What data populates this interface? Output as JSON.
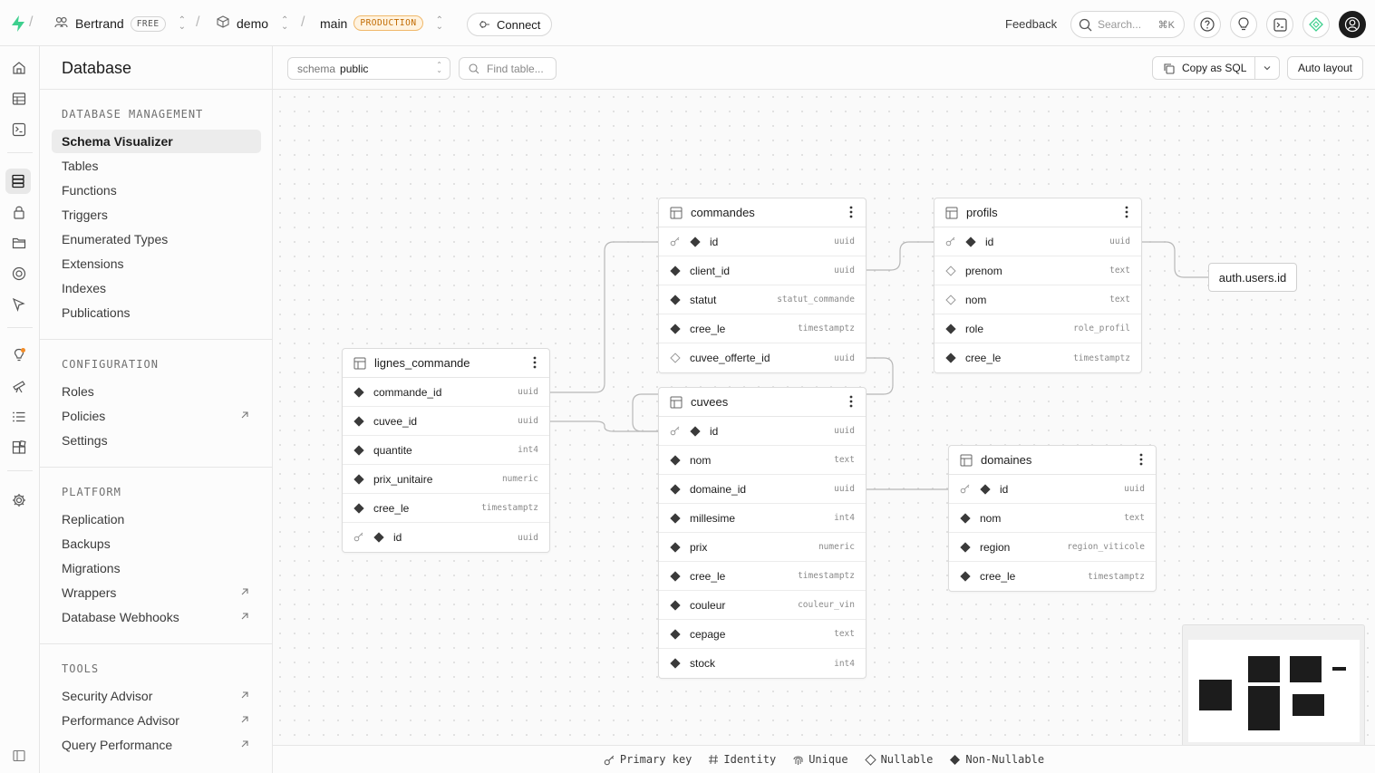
{
  "topbar": {
    "org": "Bertrand",
    "org_badge": "FREE",
    "project": "demo",
    "branch": "main",
    "branch_badge": "PRODUCTION",
    "connect_label": "Connect",
    "feedback_label": "Feedback",
    "search_placeholder": "Search...",
    "search_shortcut": "⌘K"
  },
  "sidebar": {
    "title": "Database",
    "sections": [
      {
        "heading": "DATABASE MANAGEMENT",
        "items": [
          {
            "label": "Schema Visualizer",
            "active": true
          },
          {
            "label": "Tables"
          },
          {
            "label": "Functions"
          },
          {
            "label": "Triggers"
          },
          {
            "label": "Enumerated Types"
          },
          {
            "label": "Extensions"
          },
          {
            "label": "Indexes"
          },
          {
            "label": "Publications"
          }
        ]
      },
      {
        "heading": "CONFIGURATION",
        "items": [
          {
            "label": "Roles"
          },
          {
            "label": "Policies",
            "external": true
          },
          {
            "label": "Settings"
          }
        ]
      },
      {
        "heading": "PLATFORM",
        "items": [
          {
            "label": "Replication"
          },
          {
            "label": "Backups"
          },
          {
            "label": "Migrations"
          },
          {
            "label": "Wrappers",
            "external": true
          },
          {
            "label": "Database Webhooks",
            "external": true
          }
        ]
      },
      {
        "heading": "TOOLS",
        "items": [
          {
            "label": "Security Advisor",
            "external": true
          },
          {
            "label": "Performance Advisor",
            "external": true
          },
          {
            "label": "Query Performance",
            "external": true
          }
        ]
      }
    ]
  },
  "toolbar": {
    "schema_prefix": "schema",
    "schema_value": "public",
    "find_placeholder": "Find table...",
    "copy_sql_label": "Copy as SQL",
    "auto_layout_label": "Auto layout"
  },
  "tables": [
    {
      "name": "commandes",
      "columns": [
        {
          "name": "id",
          "type": "uuid",
          "pk": true
        },
        {
          "name": "client_id",
          "type": "uuid"
        },
        {
          "name": "statut",
          "type": "statut_commande"
        },
        {
          "name": "cree_le",
          "type": "timestamptz"
        },
        {
          "name": "cuvee_offerte_id",
          "type": "uuid",
          "nullable": true
        }
      ]
    },
    {
      "name": "profils",
      "columns": [
        {
          "name": "id",
          "type": "uuid",
          "pk": true
        },
        {
          "name": "prenom",
          "type": "text",
          "nullable": true
        },
        {
          "name": "nom",
          "type": "text",
          "nullable": true
        },
        {
          "name": "role",
          "type": "role_profil"
        },
        {
          "name": "cree_le",
          "type": "timestamptz"
        }
      ]
    },
    {
      "name": "lignes_commande",
      "columns": [
        {
          "name": "commande_id",
          "type": "uuid"
        },
        {
          "name": "cuvee_id",
          "type": "uuid"
        },
        {
          "name": "quantite",
          "type": "int4"
        },
        {
          "name": "prix_unitaire",
          "type": "numeric"
        },
        {
          "name": "cree_le",
          "type": "timestamptz"
        },
        {
          "name": "id",
          "type": "uuid",
          "pk": true
        }
      ]
    },
    {
      "name": "cuvees",
      "columns": [
        {
          "name": "id",
          "type": "uuid",
          "pk": true
        },
        {
          "name": "nom",
          "type": "text"
        },
        {
          "name": "domaine_id",
          "type": "uuid"
        },
        {
          "name": "millesime",
          "type": "int4"
        },
        {
          "name": "prix",
          "type": "numeric"
        },
        {
          "name": "cree_le",
          "type": "timestamptz"
        },
        {
          "name": "couleur",
          "type": "couleur_vin"
        },
        {
          "name": "cepage",
          "type": "text"
        },
        {
          "name": "stock",
          "type": "int4"
        }
      ]
    },
    {
      "name": "domaines",
      "columns": [
        {
          "name": "id",
          "type": "uuid",
          "pk": true
        },
        {
          "name": "nom",
          "type": "text"
        },
        {
          "name": "region",
          "type": "region_viticole"
        },
        {
          "name": "cree_le",
          "type": "timestamptz"
        }
      ]
    }
  ],
  "external_ref": "auth.users.id",
  "legend": {
    "primary_key": "Primary key",
    "identity": "Identity",
    "unique": "Unique",
    "nullable": "Nullable",
    "non_nullable": "Non-Nullable"
  },
  "colors": {
    "brand": "#3ecf8e",
    "production": "#c16a00"
  }
}
